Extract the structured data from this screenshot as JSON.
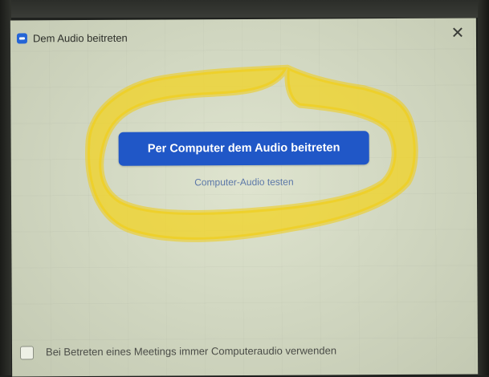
{
  "dialog": {
    "title": "Dem Audio beitreten",
    "close_symbol": "✕",
    "app_icon": "zoom-app-icon"
  },
  "main": {
    "join_button_label": "Per Computer dem Audio beitreten",
    "test_link_label": "Computer-Audio testen"
  },
  "footer": {
    "checkbox_label": "Bei Betreten eines Meetings immer Computeraudio verwenden",
    "checkbox_checked": false
  },
  "colors": {
    "accent": "#2057c7",
    "highlight": "#f2d21c",
    "dialog_bg": "#d6dcc6"
  }
}
